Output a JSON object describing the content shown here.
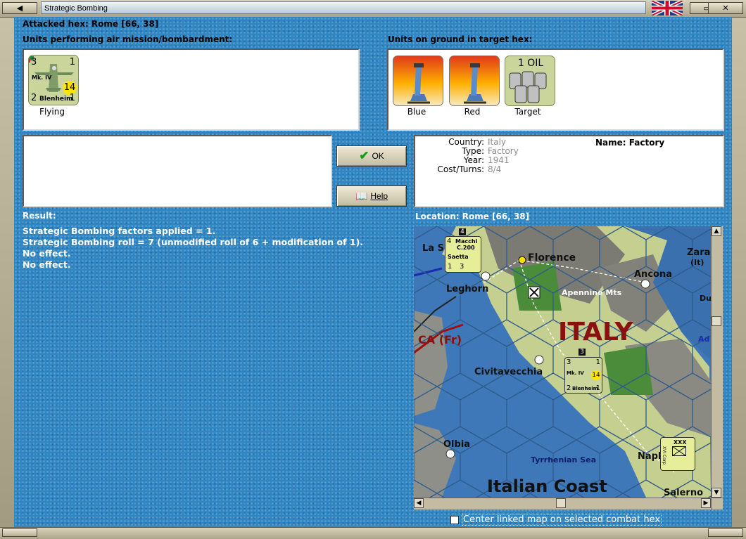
{
  "window": {
    "title": "Strategic Bombing",
    "left_button": "◀",
    "right_buttons": [
      "▭",
      "✕"
    ]
  },
  "header": {
    "attacked_hex": "Attacked hex: Rome  [66, 38]"
  },
  "air_units": {
    "label": "Units performing air mission/bombardment:",
    "units": [
      {
        "attack": "3",
        "defense": "1",
        "type": "Mk. IV",
        "movement": "14",
        "level": "2",
        "name": "Blenheim",
        "range": "1",
        "caption": "Flying"
      }
    ]
  },
  "ground_units": {
    "label": "Units on ground in target hex:",
    "units": [
      {
        "caption": "Blue",
        "icon": "flak-gun-icon"
      },
      {
        "caption": "Red",
        "icon": "flak-gun-icon"
      },
      {
        "caption": "Target",
        "icon": "oil-barrels-icon",
        "top_text": "1 OIL"
      }
    ]
  },
  "buttons": {
    "ok": "OK",
    "help": "Help"
  },
  "target_info": {
    "rows": [
      {
        "key": "Country:",
        "value": "Italy"
      },
      {
        "key": "Type:",
        "value": "Factory"
      },
      {
        "key": "Year:",
        "value": "1941"
      },
      {
        "key": "Cost/Turns:",
        "value": "8/4"
      }
    ],
    "name_label": "Name: Factory"
  },
  "result": {
    "label": "Result:",
    "lines": [
      "Strategic Bombing factors applied = 1.",
      "Strategic Bombing roll = 7 (unmodified roll of 6 + modification of 1).",
      "No effect.",
      "No effect."
    ]
  },
  "location": {
    "label": "Location:  Rome  [66, 38]"
  },
  "map": {
    "labels": {
      "la_spezia": "La S",
      "florence": "Florence",
      "ancona": "Ancona",
      "zara": "Zara",
      "zara_it": "(It)",
      "leghorn": "Leghorn",
      "apennine": "Apennine Mts",
      "italy": "ITALY",
      "corsica": "CA (Fr)",
      "civitavecchia": "Civitavecchia",
      "olbia": "Olbia",
      "tyrrhenian": "Tyrrhenian Sea",
      "naples": "Napl",
      "coast": "Italian Coast",
      "salerno": "Salerno",
      "du": "Du",
      "ad": "Ad"
    },
    "stack_count_north": "4",
    "stack_count_rome": "3",
    "unit_north": {
      "attack": "4",
      "name1": "Macchi",
      "name2": "C.200",
      "name3": "Saetta",
      "bottom1": "1",
      "bottom2": "3"
    },
    "unit_rome": {
      "attack": "3",
      "defense": "1",
      "type": "Mk. IV",
      "movement": "14",
      "level": "2",
      "name": "Blenheim",
      "range": "1"
    },
    "unit_naples": {
      "top": "XXX",
      "side": "XVI Corp"
    }
  },
  "center_checkbox": {
    "label": "Center linked map on selected combat hex",
    "checked": false
  },
  "colors": {
    "pane_blue": "#2f86c3",
    "sea": "#3f78b8",
    "land": "#c5cf8f",
    "mountain": "#7b7b73",
    "unit_counter": "#c9d59a",
    "country_red": "#8b1010"
  }
}
